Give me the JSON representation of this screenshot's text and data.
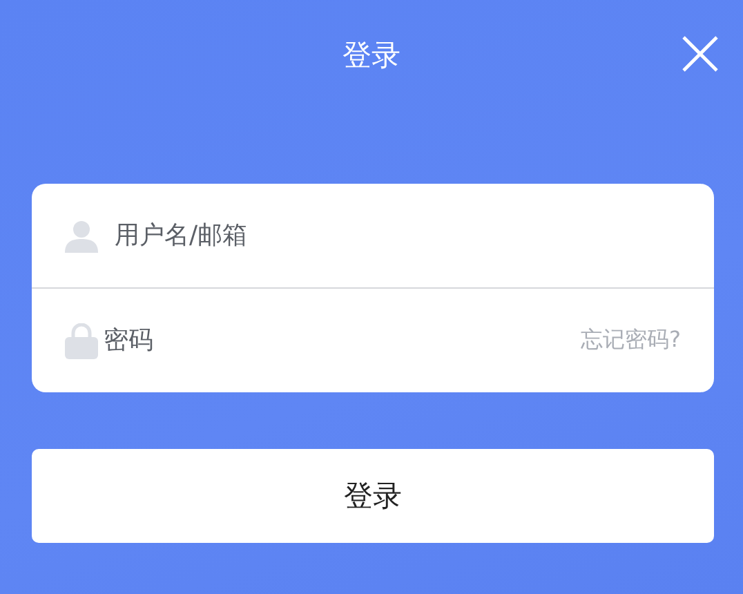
{
  "header": {
    "title": "登录"
  },
  "form": {
    "username": {
      "placeholder": "用户名/邮箱"
    },
    "password": {
      "placeholder": "密码"
    },
    "forgot_link": "忘记密码?"
  },
  "submit": "登录"
}
